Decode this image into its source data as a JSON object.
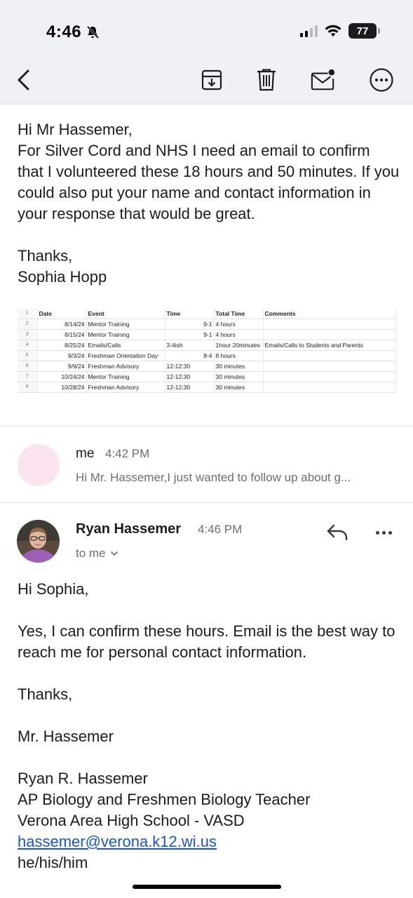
{
  "status_bar": {
    "time": "4:46",
    "battery": "77"
  },
  "toolbar": {
    "back_icon": "chevron-left-icon",
    "archive_icon": "archive-icon",
    "trash_icon": "trash-icon",
    "mark_unread_icon": "mail-unread-icon",
    "more_icon": "ellipsis-circle-icon"
  },
  "message1": {
    "greeting": "Hi Mr Hassemer,",
    "body": "For Silver Cord and NHS I need an email to confirm that I volunteered these 18 hours and 50 minutes. If you could also put your name and contact information in your response that would be great.",
    "signoff": "Thanks,",
    "signature": "Sophia Hopp"
  },
  "spreadsheet": {
    "headers": [
      "Date",
      "Event",
      "Time",
      "Total Time",
      "Comments"
    ],
    "row_numbers": [
      "1",
      "2",
      "3",
      "4",
      "5",
      "6",
      "7",
      "8",
      ""
    ],
    "rows": [
      [
        "8/14/24",
        "Mentor Training",
        "9-1",
        "4 hours",
        ""
      ],
      [
        "8/15/24",
        "Mentor Training",
        "9-1",
        "4 hours",
        ""
      ],
      [
        "8/25/24",
        "Emails/Calls",
        "3-4ish",
        "1hour 20minutes",
        "Emails/Calls to Students and Parents"
      ],
      [
        "9/3/24",
        "Freshman Orientation Day",
        "8-4",
        "8 hours",
        ""
      ],
      [
        "9/9/24",
        "Freshman Advisory",
        "12-12:30",
        "30 minutes",
        ""
      ],
      [
        "10/24/24",
        "Mentor Training",
        "12-12:30",
        "30 minutes",
        ""
      ],
      [
        "10/28/24",
        "Freshman Advisory",
        "12-12:30",
        "30 minutes",
        ""
      ]
    ]
  },
  "collapsed_message": {
    "sender": "me",
    "time": "4:42 PM",
    "snippet": "Hi Mr. Hassemer,I just wanted to follow up about g..."
  },
  "reply": {
    "sender": "Ryan Hassemer",
    "time": "4:46 PM",
    "to": "to me",
    "greeting": "Hi Sophia,",
    "body": "Yes, I can confirm these hours. Email is the best way to reach me for personal contact information.",
    "signoff": "Thanks,",
    "signature_short": "Mr. Hassemer",
    "sig_name": "Ryan R. Hassemer",
    "sig_title": "AP Biology and Freshmen Biology Teacher",
    "sig_school": "Verona Area High School - VASD",
    "sig_email": "hassemer@verona.k12.wi.us",
    "sig_pronouns": "he/his/him"
  },
  "colors": {
    "toolbar_bg": "#eef2f6",
    "link": "#1a56c8",
    "secondary_text": "#6e6e73",
    "avatar_pink": "#f9e4ef"
  }
}
